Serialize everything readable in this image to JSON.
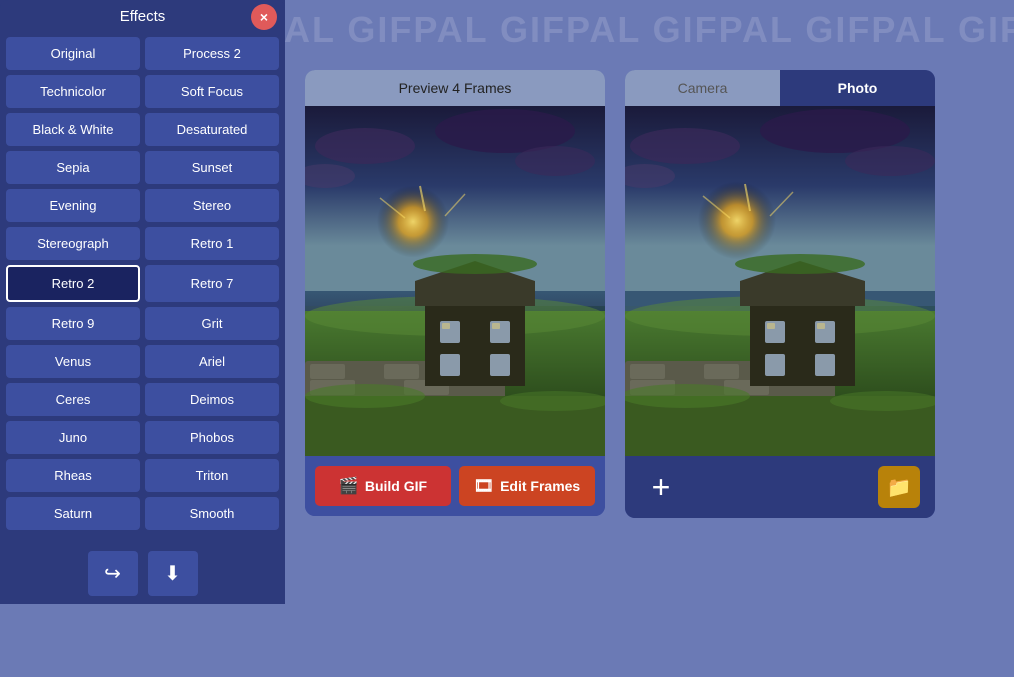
{
  "app": {
    "watermark": "GIFPAL GIFPAL GIFPAL GIFPAL GIFPAL"
  },
  "effects": {
    "title": "Effects",
    "close_label": "×",
    "items": [
      {
        "id": "original",
        "label": "Original",
        "col": 0,
        "active": false
      },
      {
        "id": "process2",
        "label": "Process 2",
        "col": 1,
        "active": false
      },
      {
        "id": "technicolor",
        "label": "Technicolor",
        "col": 0,
        "active": false
      },
      {
        "id": "softfocus",
        "label": "Soft Focus",
        "col": 1,
        "active": false
      },
      {
        "id": "bw",
        "label": "Black & White",
        "col": 0,
        "active": false
      },
      {
        "id": "desaturated",
        "label": "Desaturated",
        "col": 1,
        "active": false
      },
      {
        "id": "sepia",
        "label": "Sepia",
        "col": 0,
        "active": false
      },
      {
        "id": "sunset",
        "label": "Sunset",
        "col": 1,
        "active": false
      },
      {
        "id": "evening",
        "label": "Evening",
        "col": 0,
        "active": false
      },
      {
        "id": "stereo",
        "label": "Stereo",
        "col": 1,
        "active": false
      },
      {
        "id": "stereograph",
        "label": "Stereograph",
        "col": 0,
        "active": false
      },
      {
        "id": "retro1",
        "label": "Retro 1",
        "col": 1,
        "active": false
      },
      {
        "id": "retro2",
        "label": "Retro 2",
        "col": 0,
        "active": true
      },
      {
        "id": "retro7",
        "label": "Retro 7",
        "col": 1,
        "active": false
      },
      {
        "id": "retro9",
        "label": "Retro 9",
        "col": 0,
        "active": false
      },
      {
        "id": "grit",
        "label": "Grit",
        "col": 1,
        "active": false
      },
      {
        "id": "venus",
        "label": "Venus",
        "col": 0,
        "active": false
      },
      {
        "id": "ariel",
        "label": "Ariel",
        "col": 1,
        "active": false
      },
      {
        "id": "ceres",
        "label": "Ceres",
        "col": 0,
        "active": false
      },
      {
        "id": "deimos",
        "label": "Deimos",
        "col": 1,
        "active": false
      },
      {
        "id": "juno",
        "label": "Juno",
        "col": 0,
        "active": false
      },
      {
        "id": "phobos",
        "label": "Phobos",
        "col": 1,
        "active": false
      },
      {
        "id": "rheas",
        "label": "Rheas",
        "col": 0,
        "active": false
      },
      {
        "id": "triton",
        "label": "Triton",
        "col": 1,
        "active": false
      },
      {
        "id": "saturn",
        "label": "Saturn",
        "col": 0,
        "active": false
      },
      {
        "id": "smooth",
        "label": "Smooth",
        "col": 1,
        "active": false
      }
    ],
    "footer": {
      "share_label": "↪",
      "download_label": "⬇"
    }
  },
  "preview": {
    "header": "Preview 4 Frames",
    "build_gif_label": "Build GIF",
    "edit_frames_label": "Edit Frames"
  },
  "photo": {
    "camera_tab": "Camera",
    "photo_tab": "Photo",
    "active_tab": "photo"
  }
}
